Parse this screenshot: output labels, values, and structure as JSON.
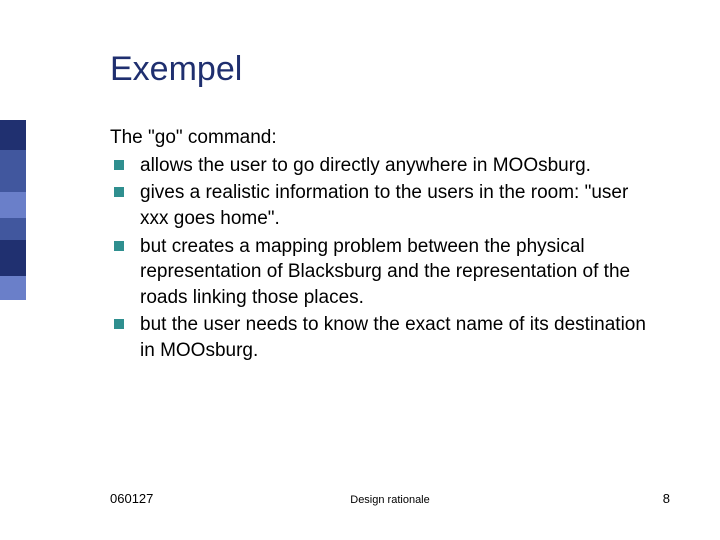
{
  "title": "Exempel",
  "intro": "The \"go\" command:",
  "bullets": [
    "allows the user to go directly anywhere in MOOsburg.",
    "gives a realistic information to the users in the room: \"user xxx goes home\".",
    "but creates a mapping problem between the physical representation of Blacksburg and the representation of the roads linking those places.",
    "but the user needs to know the exact name of its destination in MOOsburg."
  ],
  "sidebar_colors": [
    "#203070",
    "#41579e",
    "#6a7fc9",
    "#41579e",
    "#203070",
    "#6a7fc9"
  ],
  "sidebar_heights": [
    30,
    42,
    26,
    22,
    36,
    24
  ],
  "footer": {
    "date": "060127",
    "center": "Design rationale",
    "page": "8"
  }
}
